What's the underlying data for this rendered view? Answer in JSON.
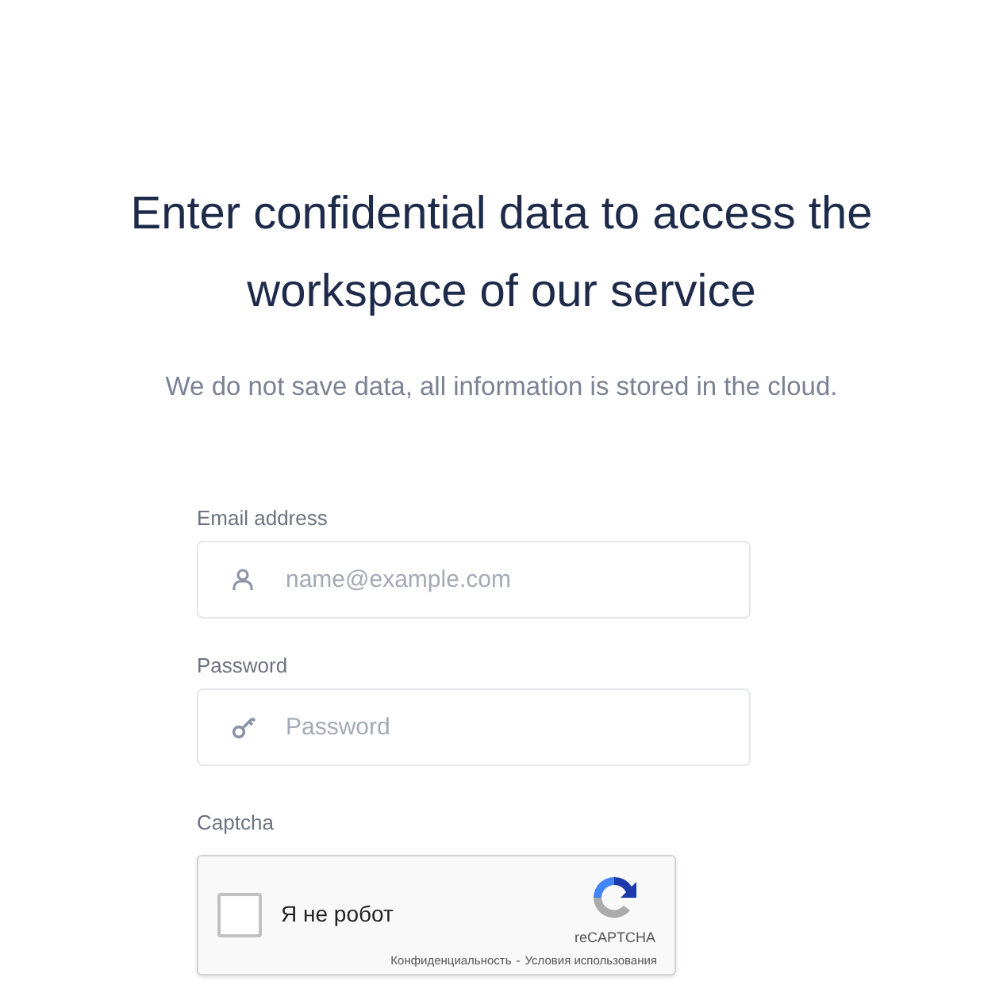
{
  "heading": "Enter confidential data to access the workspace of our service",
  "subtitle": "We do not save data, all information is stored in the cloud.",
  "fields": [
    {
      "label": "Email address",
      "placeholder": "name@example.com",
      "kind": "email"
    },
    {
      "label": "Password",
      "placeholder": "Password",
      "kind": "password"
    }
  ],
  "captcha": {
    "label": "Captcha",
    "checkbox_label": "Я не робот",
    "checked": false,
    "brand": "reCAPTCHA",
    "privacy": "Конфиденциальность",
    "separator": "-",
    "terms": "Условия использования"
  }
}
